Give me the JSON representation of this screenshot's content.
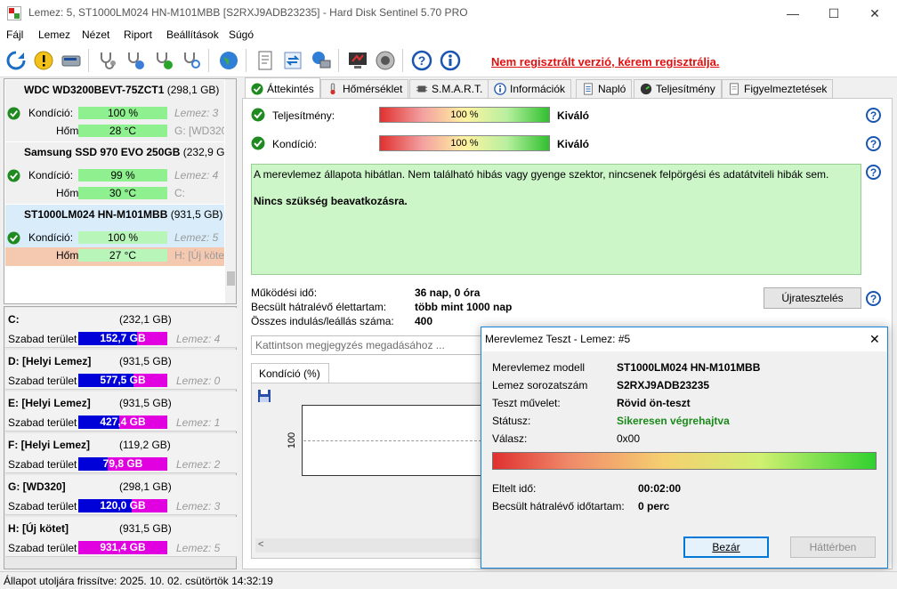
{
  "window": {
    "title": "Lemez: 5, ST1000LM024 HN-M101MBB [S2RXJ9ADB23235]  -  Hard Disk Sentinel 5.70 PRO",
    "minimize": "—",
    "maximize": "☐",
    "close": "✕"
  },
  "menu": [
    "Fájl",
    "Lemez",
    "Nézet",
    "Riport",
    "Beállítások",
    "Súgó"
  ],
  "toolbar": {
    "register_link": "Nem regisztrált verzió, kérem regisztrálja."
  },
  "disks": [
    {
      "name": "WDC WD3200BEVT-75ZCT1",
      "size": "(298,1 GB)",
      "condition_label": "Kondíció:",
      "condition": "100 %",
      "temp_label": "Hőm.:",
      "temp": "28 °C",
      "disk_index": "Lemez: 3",
      "drive": "G: [WD320"
    },
    {
      "name": "Samsung SSD 970 EVO 250GB",
      "size": "(232,9 GB)",
      "condition_label": "Kondíció:",
      "condition": "99 %",
      "temp_label": "Hőm.:",
      "temp": "30 °C",
      "disk_index": "Lemez: 4",
      "drive": "C:"
    },
    {
      "name": "ST1000LM024 HN-M101MBB",
      "size": "(931,5 GB)",
      "condition_label": "Kondíció:",
      "condition": "100 %",
      "temp_label": "Hőm.:",
      "temp": "27 °C",
      "disk_index": "Lemez: 5",
      "drive": "H: [Új kötet"
    }
  ],
  "partitions": [
    {
      "name": "C:",
      "size": "(232,1 GB)",
      "free_label": "Szabad terület",
      "free": "152,7 GB",
      "free_ratio": 0.66,
      "disk": "Lemez: 4"
    },
    {
      "name": "D: [Helyi Lemez]",
      "size": "(931,5 GB)",
      "free_label": "Szabad terület",
      "free": "577,5 GB",
      "free_ratio": 0.62,
      "disk": "Lemez: 0"
    },
    {
      "name": "E: [Helyi Lemez]",
      "size": "(931,5 GB)",
      "free_label": "Szabad terület",
      "free": "427,4 GB",
      "free_ratio": 0.46,
      "disk": "Lemez: 1"
    },
    {
      "name": "F: [Helyi Lemez]",
      "size": "(119,2 GB)",
      "free_label": "Szabad terület",
      "free": "79,8 GB",
      "free_ratio": 0.33,
      "disk": "Lemez: 2"
    },
    {
      "name": "G: [WD320]",
      "size": "(298,1 GB)",
      "free_label": "Szabad terület",
      "free": "120,0 GB",
      "free_ratio": 0.6,
      "disk": "Lemez: 3"
    },
    {
      "name": "H: [Új kötet]",
      "size": "(931,5 GB)",
      "free_label": "Szabad terület",
      "free": "931,4 GB",
      "free_ratio": 0.0,
      "disk": "Lemez: 5"
    }
  ],
  "tabs": [
    "Áttekintés",
    "Hőmérséklet",
    "S.M.A.R.T.",
    "Információk",
    "Napló",
    "Teljesítmény",
    "Figyelmeztetések"
  ],
  "overview": {
    "performance_label": "Teljesítmény:",
    "performance_value": "100 %",
    "performance_rating": "Kiváló",
    "condition_label": "Kondíció:",
    "condition_value": "100 %",
    "condition_rating": "Kiváló",
    "status_text": "A merevlemez állapota hibátlan. Nem található hibás vagy gyenge szektor, nincsenek felpörgési és adatátviteli hibák sem.",
    "status_action": "Nincs szükség beavatkozásra.",
    "uptime_label": "Működési idő:",
    "uptime_value": "36 nap, 0 óra",
    "lifetime_label": "Becsült hátralévő élettartam:",
    "lifetime_value": "több mint 1000 nap",
    "starts_label": "Összes indulás/leállás száma:",
    "starts_value": "400",
    "restart_button": "Újratesztelés",
    "comment_placeholder": "Kattintson megjegyzés megadásához ...",
    "chart_tab": "Kondíció  (%)",
    "chart_axis_value": "100"
  },
  "dialog": {
    "title": "Merevlemez Teszt - Lemez: #5",
    "close": "✕",
    "model_label": "Merevlemez modell",
    "model_value": "ST1000LM024 HN-M101MBB",
    "serial_label": "Lemez sorozatszám",
    "serial_value": "S2RXJ9ADB23235",
    "operation_label": "Teszt művelet:",
    "operation_value": "Rövid ön-teszt",
    "status_label": "Státusz:",
    "status_value": "Sikeresen végrehajtva",
    "response_label": "Válasz:",
    "response_value": "0x00",
    "elapsed_label": "Eltelt idő:",
    "elapsed_value": "00:02:00",
    "remaining_label": "Becsült hátralévő időtartam:",
    "remaining_value": "0 perc",
    "close_button": "Bezár",
    "background_button": "Háttérben",
    "status_color": "#1a8a1a"
  },
  "statusbar": {
    "text": "Állapot utoljára frissítve: 2025. 10. 02. csütörtök 14:32:19"
  }
}
